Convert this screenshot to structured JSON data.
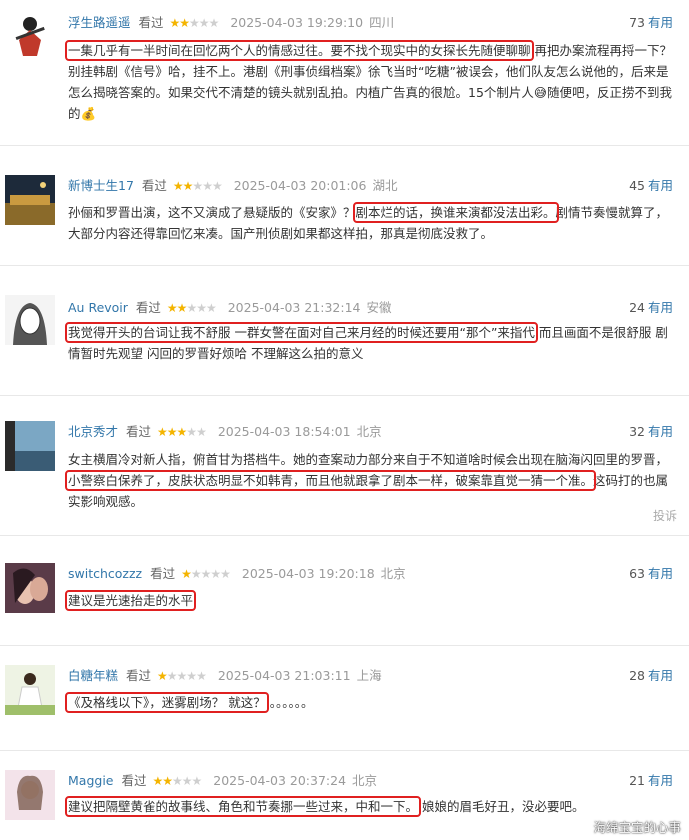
{
  "common": {
    "watched": "看过",
    "useful_suffix": "有用",
    "report": "投诉"
  },
  "reviews": [
    {
      "username": "浮生路遥遥",
      "stars": 2,
      "time": "2025-04-03 19:29:10",
      "location": "四川",
      "useful_count": "73",
      "text_highlight": "一集几乎有一半时间在回忆两个人的情感过往。要不找个现实中的女探长先随便聊聊",
      "text_rest": "再把办案流程再捋一下？别挂韩剧《信号》哈，挂不上。港剧《刑事侦缉档案》徐飞当时“吃糖”被误会，他们队友怎么说他的，后来是怎么揭晓答案的。如果交代不清楚的镜头就别乱拍。内植广告真的很尬。15个制片人😅随便吧，反正捞不到我的💰"
    },
    {
      "username": "新博士生17",
      "stars": 2,
      "time": "2025-04-03 20:01:06",
      "location": "湖北",
      "useful_count": "45",
      "text_before": "孙俪和罗晋出演，这不又演成了悬疑版的《安家》？",
      "text_highlight": "剧本烂的话，换谁来演都没法出彩。",
      "text_after": "剧情节奏慢就算了，大部分内容还得靠回忆来凑。国产刑侦剧如果都这样拍，那真是彻底没救了。"
    },
    {
      "username": "Au Revoir",
      "stars": 2,
      "time": "2025-04-03 21:32:14",
      "location": "安徽",
      "useful_count": "24",
      "text_highlight": "我觉得开头的台词让我不舒服 一群女警在面对自己来月经的时候还要用“那个”来指代",
      "text_rest": "而且画面不是很舒服 剧情暂时先观望 闪回的罗晋好烦哈 不理解这么拍的意义"
    },
    {
      "username": "北京秀才",
      "stars": 3,
      "time": "2025-04-03 18:54:01",
      "location": "北京",
      "useful_count": "32",
      "text_before": "女主横眉冷对新人指，俯首甘为搭档牛。她的查案动力部分来自于不知道啥时候会出现在脑海闪回里的罗晋，",
      "text_highlight": "小警察白保养了，皮肤状态明显不如韩青，而且他就跟拿了剧本一样，破案靠直觉一猜一个准。",
      "text_after": "这码打的也属实影响观感。",
      "show_report": true
    },
    {
      "username": "switchcozzz",
      "stars": 1,
      "time": "2025-04-03 19:20:18",
      "location": "北京",
      "useful_count": "63",
      "text_highlight": "建议是光速抬走的水平"
    },
    {
      "username": "白糖年糕",
      "stars": 1,
      "time": "2025-04-03 21:03:11",
      "location": "上海",
      "useful_count": "28",
      "text_highlight": "《及格线以下》，迷雾剧场？ 就这？",
      "text_rest": "。。。。。。"
    },
    {
      "username": "Maggie",
      "stars": 2,
      "time": "2025-04-03 20:37:24",
      "location": "北京",
      "useful_count": "21",
      "text_highlight": "建议把隔壁黄雀的故事线、角色和节奏挪一些过来，中和一下。",
      "text_rest": "娘娘的眉毛好丑，没必要吧。"
    }
  ],
  "watermark": "海绵宝宝的心事"
}
